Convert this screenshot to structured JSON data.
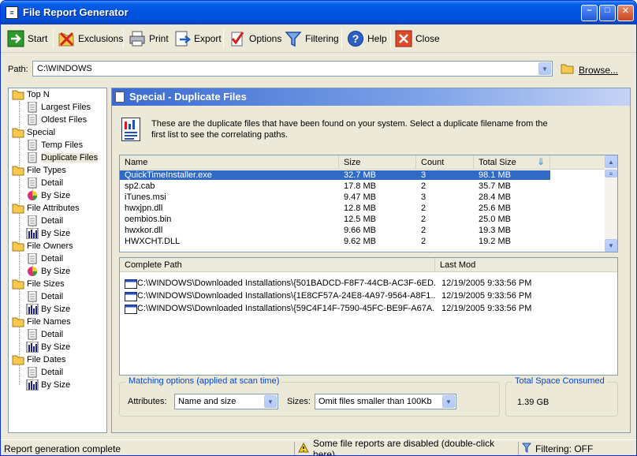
{
  "window": {
    "title": "File Report Generator"
  },
  "toolbar": {
    "start": "Start",
    "exclusions": "Exclusions",
    "print": "Print",
    "export": "Export",
    "options": "Options",
    "filtering": "Filtering",
    "help": "Help",
    "close": "Close"
  },
  "path": {
    "label": "Path:",
    "value": "C:\\WINDOWS",
    "browse": "Browse..."
  },
  "tree": {
    "top_n": "Top N",
    "largest": "Largest Files",
    "oldest": "Oldest Files",
    "special": "Special",
    "temp": "Temp Files",
    "duplicate": "Duplicate Files",
    "file_types": "File Types",
    "ft_detail": "Detail",
    "ft_bysize": "By Size",
    "file_attributes": "File Attributes",
    "fa_detail": "Detail",
    "fa_bysize": "By Size",
    "file_owners": "File Owners",
    "fo_detail": "Detail",
    "fo_bysize": "By Size",
    "file_sizes": "File Sizes",
    "fs_detail": "Detail",
    "fs_bysize": "By Size",
    "file_names": "File Names",
    "fn_detail": "Detail",
    "fn_bysize": "By Size",
    "file_dates": "File Dates",
    "fd_detail": "Detail",
    "fd_bysize": "By Size"
  },
  "panel": {
    "title": "Special - Duplicate Files",
    "description": "These are the duplicate files that have been found on your system. Select a duplicate filename from the first list to see the correlating paths."
  },
  "dup_list": {
    "headers": {
      "name": "Name",
      "size": "Size",
      "count": "Count",
      "total": "Total Size"
    },
    "rows": [
      {
        "name": "QuickTimeInstaller.exe",
        "size": "32.7 MB",
        "count": "3",
        "total": "98.1 MB"
      },
      {
        "name": "sp2.cab",
        "size": "17.8 MB",
        "count": "2",
        "total": "35.7 MB"
      },
      {
        "name": "iTunes.msi",
        "size": "9.47 MB",
        "count": "3",
        "total": "28.4 MB"
      },
      {
        "name": "hwxjpn.dll",
        "size": "12.8 MB",
        "count": "2",
        "total": "25.6 MB"
      },
      {
        "name": "oembios.bin",
        "size": "12.5 MB",
        "count": "2",
        "total": "25.0 MB"
      },
      {
        "name": "hwxkor.dll",
        "size": "9.66 MB",
        "count": "2",
        "total": "19.3 MB"
      },
      {
        "name": "HWXCHT.DLL",
        "size": "9.62 MB",
        "count": "2",
        "total": "19.2 MB"
      }
    ]
  },
  "path_list": {
    "headers": {
      "path": "Complete Path",
      "lastmod": "Last Mod"
    },
    "rows": [
      {
        "path": "C:\\WINDOWS\\Downloaded Installations\\{501BADCD-F8F7-44CB-AC3F-6ED...",
        "lastmod": "12/19/2005 9:33:56 PM"
      },
      {
        "path": "C:\\WINDOWS\\Downloaded Installations\\{1E8CF57A-24E8-4A97-9564-A8F1...",
        "lastmod": "12/19/2005 9:33:56 PM"
      },
      {
        "path": "C:\\WINDOWS\\Downloaded Installations\\{59C4F14F-7590-45FC-BE9F-A67A...",
        "lastmod": "12/19/2005 9:33:56 PM"
      }
    ]
  },
  "matching": {
    "label": "Matching options (applied at scan time)",
    "attributes_label": "Attributes:",
    "attributes_value": "Name and size",
    "sizes_label": "Sizes:",
    "sizes_value": "Omit files smaller than 100Kb"
  },
  "space": {
    "label": "Total Space Consumed",
    "value": "1.39 GB"
  },
  "status": {
    "left": "Report generation complete",
    "middle": "Some file reports are disabled (double-click here)",
    "right": "Filtering: OFF"
  }
}
